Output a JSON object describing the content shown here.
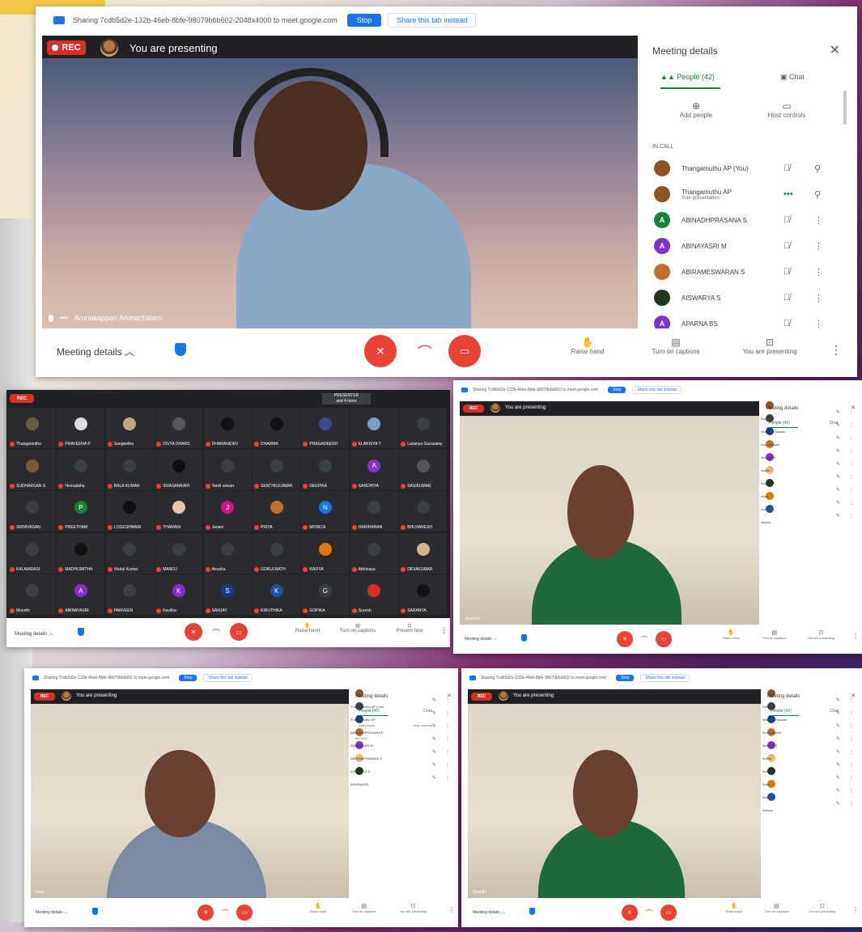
{
  "colors": {
    "rec": "#d93025",
    "accent": "#1a73e8",
    "green": "#188038",
    "red": "#ea4335",
    "dark": "#202124"
  },
  "main": {
    "share_bar": {
      "text": "Sharing 7cdb5d2e-132b-46eb-8bfe-98079b6b602-2048x4000 to meet.google.com",
      "stop": "Stop",
      "hide": "Share this tab instead"
    },
    "rec": "REC",
    "presenting": "You are presenting",
    "caption": "Arunakappan Arunachalam",
    "details": {
      "title": "Meeting details",
      "tab_people": "People (42)",
      "tab_chat": "Chat",
      "add_people": "Add people",
      "host_controls": "Host controls",
      "in_call": "IN CALL"
    },
    "people": [
      {
        "name": "Thangamuthu AP (You)",
        "sub": "",
        "initial": "",
        "color": "#8d5524"
      },
      {
        "name": "Thangamuthu AP",
        "sub": "Your presentation",
        "initial": "",
        "color": "#8d5524"
      },
      {
        "name": "ABINADHPRASANA S",
        "sub": "",
        "initial": "A",
        "color": "#188038"
      },
      {
        "name": "ABINAYASRI M",
        "sub": "",
        "initial": "A",
        "color": "#8430ce"
      },
      {
        "name": "ABIRAMESWARAN S",
        "sub": "",
        "initial": "",
        "color": "#c26e2b"
      },
      {
        "name": "AISWARYA S",
        "sub": "",
        "initial": "",
        "color": "#1e3a1e"
      },
      {
        "name": "APARNA BS",
        "sub": "",
        "initial": "A",
        "color": "#8430ce"
      }
    ],
    "bottom": {
      "meeting_details": "Meeting details",
      "raise_hand": "Raise hand",
      "captions": "Turn on captions",
      "presenting": "You are presenting"
    }
  },
  "grid": {
    "rec": "REC",
    "bottom": {
      "meeting_details": "Meeting details",
      "raise_hand": "Raise hand",
      "captions": "Turn on captions",
      "present": "Present now"
    },
    "top_label": "PRESENTER\nand 4 more",
    "tiles": [
      {
        "n": "Thangamuthu",
        "c": "#6b5a4a",
        "i": ""
      },
      {
        "n": "PRAVEENA P",
        "c": "#ddd",
        "i": ""
      },
      {
        "n": "Sangeetha",
        "c": "#c2a68a",
        "i": ""
      },
      {
        "n": "DIVYA DHARS",
        "c": "#555",
        "i": ""
      },
      {
        "n": "DHARANIDEV",
        "c": "#111",
        "i": ""
      },
      {
        "n": "DHARMA",
        "c": "#111",
        "i": ""
      },
      {
        "n": "PRAGADEESH",
        "c": "#3c4a8a",
        "i": ""
      },
      {
        "n": "ELAKKIYA T",
        "c": "#7aa2c8",
        "i": ""
      },
      {
        "n": "Lavanya Gurusamy",
        "c": "#3c4043",
        "i": ""
      },
      {
        "n": "SUDHARSAN S",
        "c": "#7a5a3a",
        "i": ""
      },
      {
        "n": "Hemalatha",
        "c": "#3c4043",
        "i": ""
      },
      {
        "n": "BALA KUMAR",
        "c": "#3c4043",
        "i": ""
      },
      {
        "n": "SIVASANKARI",
        "c": "#111",
        "i": ""
      },
      {
        "n": "Tamil selvan",
        "c": "#3c4043",
        "i": ""
      },
      {
        "n": "SENTHILKUMAR",
        "c": "#3c4043",
        "i": ""
      },
      {
        "n": "DEEPIKA",
        "c": "#3c4043",
        "i": ""
      },
      {
        "n": "SANDHIYA",
        "c": "#8430ce",
        "i": "A"
      },
      {
        "n": "SASIKUMAR",
        "c": "#555",
        "i": ""
      },
      {
        "n": "SRINIVASAN",
        "c": "#3c4043",
        "i": ""
      },
      {
        "n": "PREETHAM",
        "c": "#188038",
        "i": "P"
      },
      {
        "n": "LOGESHWARI",
        "c": "#111",
        "i": ""
      },
      {
        "n": "THARANI",
        "c": "#e6c4b0",
        "i": ""
      },
      {
        "n": "Janani",
        "c": "#d01884",
        "i": "J"
      },
      {
        "n": "PRIYA",
        "c": "#c26e2b",
        "i": ""
      },
      {
        "n": "MONICA",
        "c": "#1a73e8",
        "i": "N"
      },
      {
        "n": "HARIHARAN",
        "c": "#3c4043",
        "i": ""
      },
      {
        "n": "BHUVANESH",
        "c": "#3c4043",
        "i": ""
      },
      {
        "n": "KALAIARASI",
        "c": "#3c4043",
        "i": ""
      },
      {
        "n": "MADHUMITHA",
        "c": "#111",
        "i": ""
      },
      {
        "n": "Vishal Kumar",
        "c": "#3c4043",
        "i": ""
      },
      {
        "n": "MANOJ",
        "c": "#3c4043",
        "i": ""
      },
      {
        "n": "Anusha",
        "c": "#3c4043",
        "i": ""
      },
      {
        "n": "GOKULNATH",
        "c": "#3c4043",
        "i": ""
      },
      {
        "n": "KAVIYA",
        "c": "#e37400",
        "i": ""
      },
      {
        "n": "Abhinaya",
        "c": "#3c4043",
        "i": ""
      },
      {
        "n": "DEVAKUMAR",
        "c": "#cfb48a",
        "i": ""
      },
      {
        "n": "Moorthi",
        "c": "#3c4043",
        "i": ""
      },
      {
        "n": "ABINAYASRI",
        "c": "#8430ce",
        "i": "A"
      },
      {
        "n": "PARVEEN",
        "c": "#3c4043",
        "i": ""
      },
      {
        "n": "Kavitha",
        "c": "#8430ce",
        "i": "K"
      },
      {
        "n": "SANJAY",
        "c": "#1a3a8a",
        "i": "S"
      },
      {
        "n": "KIRUTHIKA",
        "c": "#2050a0",
        "i": "K"
      },
      {
        "n": "GOPIKA",
        "c": "#3c4043",
        "i": "G"
      },
      {
        "n": "Suresh",
        "c": "#d93025",
        "i": ""
      },
      {
        "n": "SARANYA",
        "c": "#111",
        "i": ""
      }
    ]
  },
  "small": [
    {
      "share_text": "Sharing 7cdb5d2e-132b-46eb-8bfe-98079b6b602 to meet.google.com",
      "stop": "Stop",
      "hide": "Share this tab instead",
      "rec": "REC",
      "presenting": "You are presenting",
      "details_title": "Meeting details",
      "tab_people": "People (42)",
      "tab_chat": "Chat",
      "names": [
        "Bala Y",
        "Ahamed Hussain",
        "Anu Lakshmi",
        "Abinaya S",
        "Anitha",
        "Anusha",
        "Arjun",
        "Arun",
        "Ashwin"
      ],
      "meeting_details": "Meeting details",
      "raise": "Raise hand",
      "captions": "Turn on captions",
      "present": "You are presenting",
      "caption": "Jeyanthi"
    },
    {
      "share_text": "Sharing 7cdb5d2e-132b-46eb-8bfe-98079b6b602 to meet.google.com",
      "stop": "Stop",
      "hide": "Share this tab instead",
      "rec": "REC",
      "presenting": "You are presenting",
      "details_title": "Meeting details",
      "tab_people": "People (42)",
      "tab_chat": "Chat",
      "add_people": "Add people",
      "host_controls": "Host controls",
      "in_call": "IN CALL",
      "names": [
        "Thangamuthu AP (You)",
        "Thangamuthu AP",
        "ABINADHPRASANA S",
        "ABINAYASRI M",
        "ABIRAMESWARAN S",
        "AISWARYA S",
        "APARNA BS"
      ],
      "meeting_details": "Meeting details",
      "raise": "Raise hand",
      "captions": "Turn on captions",
      "present": "You are presenting",
      "caption": "Ravi"
    },
    {
      "share_text": "Sharing 7cdb5d2e-132b-46eb-8bfe-98079b6b602 to meet.google.com",
      "stop": "Stop",
      "hide": "Share this tab instead",
      "rec": "REC",
      "presenting": "You are presenting",
      "details_title": "Meeting details",
      "tab_people": "People (42)",
      "tab_chat": "Chat",
      "names": [
        "Bala Y",
        "Ahamed Hussain",
        "Anu Lakshmi",
        "Abinaya S",
        "Anitha",
        "Anusha",
        "Arjun",
        "Arun",
        "Ashwin"
      ],
      "meeting_details": "Meeting details",
      "raise": "Raise hand",
      "captions": "Turn on captions",
      "present": "You are presenting",
      "caption": "Shanthi"
    }
  ]
}
